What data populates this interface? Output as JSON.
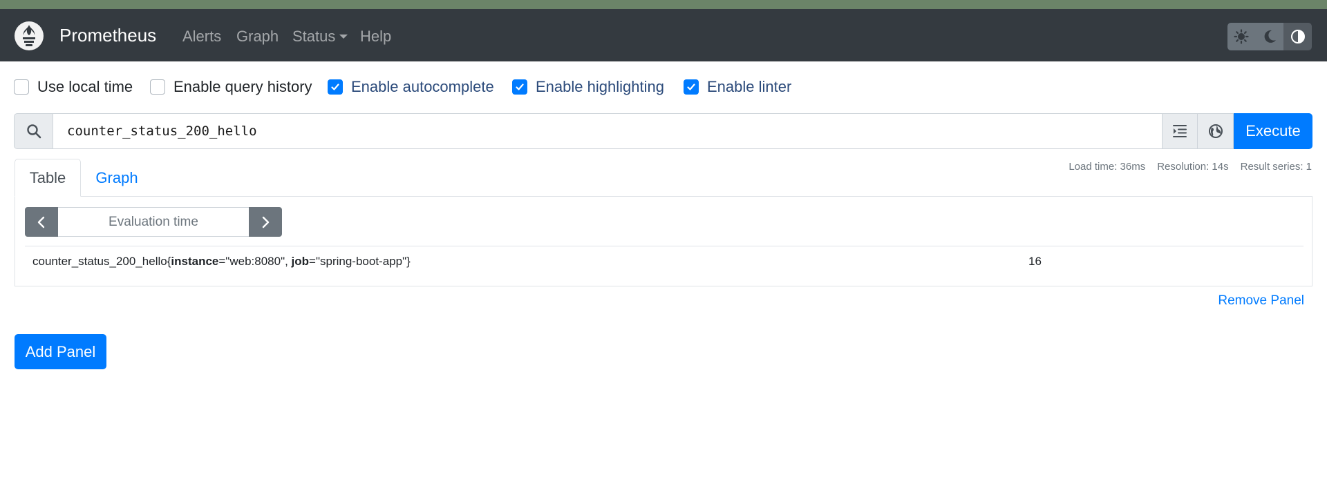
{
  "navbar": {
    "brand": "Prometheus",
    "links": [
      "Alerts",
      "Graph",
      "Status",
      "Help"
    ],
    "theme_buttons": [
      "sun-icon",
      "moon-icon",
      "contrast-icon"
    ],
    "background": "#343a40"
  },
  "options": [
    {
      "label": "Use local time",
      "checked": false
    },
    {
      "label": "Enable query history",
      "checked": false
    },
    {
      "label": "Enable autocomplete",
      "checked": true
    },
    {
      "label": "Enable highlighting",
      "checked": true
    },
    {
      "label": "Enable linter",
      "checked": true
    }
  ],
  "query": {
    "expression": "counter_status_200_hello",
    "execute_label": "Execute"
  },
  "stats": {
    "load_time": "Load time: 36ms",
    "resolution": "Resolution: 14s",
    "result_series": "Result series: 1"
  },
  "tabs": [
    "Table",
    "Graph"
  ],
  "table": {
    "eval_placeholder": "Evaluation time",
    "row": {
      "metric": "counter_status_200_hello",
      "open": "{",
      "label1_key": "instance",
      "label1_val": "=\"web:8080\", ",
      "label2_key": "job",
      "label2_val": "=\"spring-boot-app\"",
      "close": "}",
      "value": "16"
    }
  },
  "remove_panel": "Remove Panel",
  "add_panel": "Add Panel",
  "colors": {
    "accent": "#007bff",
    "secondary": "#6c757d"
  }
}
